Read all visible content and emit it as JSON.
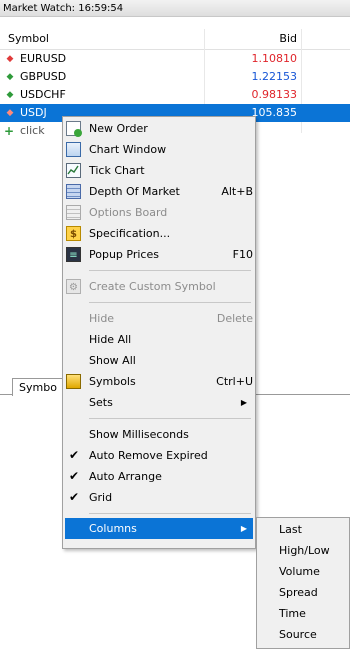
{
  "window": {
    "title": "Market Watch: 16:59:54"
  },
  "table": {
    "headers": {
      "symbol": "Symbol",
      "bid": "Bid"
    },
    "rows": [
      {
        "direction": "down",
        "symbol": "EURUSD",
        "bid": "1.10810",
        "bid_color": "red"
      },
      {
        "direction": "up",
        "symbol": "GBPUSD",
        "bid": "1.22153",
        "bid_color": "blue"
      },
      {
        "direction": "up",
        "symbol": "USDCHF",
        "bid": "0.98133",
        "bid_color": "red"
      },
      {
        "direction": "down",
        "symbol": "USDJ",
        "bid": "105.835",
        "bid_color": "white",
        "selected": true
      }
    ],
    "add_row_label": "click",
    "add_icon": "plus-icon"
  },
  "tabs": {
    "symbols_partial": "Symbo"
  },
  "menu": {
    "items": [
      {
        "label": "New Order",
        "icon": "new-order-icon"
      },
      {
        "label": "Chart Window",
        "icon": "chart-window-icon"
      },
      {
        "label": "Tick Chart",
        "icon": "tick-chart-icon"
      },
      {
        "label": "Depth Of Market",
        "shortcut": "Alt+B",
        "icon": "depth-of-market-icon"
      },
      {
        "label": "Options Board",
        "icon": "options-board-icon",
        "disabled": true
      },
      {
        "label": "Specification...",
        "icon": "specification-icon"
      },
      {
        "label": "Popup Prices",
        "shortcut": "F10",
        "icon": "popup-prices-icon"
      },
      {
        "label": "Create Custom Symbol",
        "icon": "custom-symbol-icon",
        "disabled": true
      },
      {
        "label": "Hide",
        "shortcut": "Delete",
        "disabled": true
      },
      {
        "label": "Hide All"
      },
      {
        "label": "Show All"
      },
      {
        "label": "Symbols",
        "shortcut": "Ctrl+U",
        "icon": "symbols-icon"
      },
      {
        "label": "Sets",
        "submenu": true
      },
      {
        "label": "Show Milliseconds"
      },
      {
        "label": "Auto Remove Expired",
        "checked": true
      },
      {
        "label": "Auto Arrange",
        "checked": true
      },
      {
        "label": "Grid",
        "checked": true
      },
      {
        "label": "Columns",
        "submenu": true,
        "highlighted": true
      }
    ],
    "check_glyph": "✔",
    "arrow_glyph": "▶"
  },
  "columns_submenu": {
    "items": [
      "Last",
      "High/Low",
      "Volume",
      "Spread",
      "Time",
      "Source"
    ]
  },
  "colors": {
    "selection": "#0b74d6",
    "down_arrow": "#e03a3a",
    "up_arrow": "#2e9a3a",
    "bid_red": "#e0252b",
    "bid_blue": "#1756d6"
  }
}
